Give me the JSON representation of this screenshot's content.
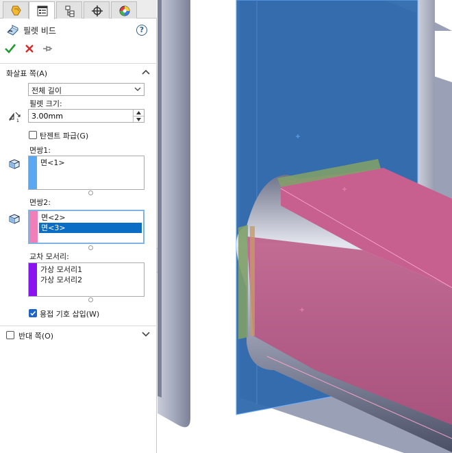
{
  "panel": {
    "title": "필렛 비드",
    "help_glyph": "?",
    "tabs": [
      "feature-manager-icon",
      "property-manager-icon",
      "configuration-manager-icon",
      "dimxpert-icon",
      "display-manager-icon"
    ],
    "actions": {
      "ok": "check-icon",
      "cancel": "close-icon",
      "pin": "pushpin-icon"
    },
    "arrow_side": {
      "header": "화살표 쪽(A)",
      "type_value": "전체 길이",
      "size_label": "필렛 크기:",
      "size_value": "3.00mm",
      "tangent_label": "탄젠트 파급(G)",
      "tangent_checked": false,
      "face_set1_label": "면쌍1:",
      "face_set1_items": [
        "면<1>"
      ],
      "face_set2_label": "면쌍2:",
      "face_set2_items": [
        "면<2>",
        "면<3>"
      ],
      "face_set2_selected": 1,
      "intersect_label": "교차 모서리:",
      "intersect_items": [
        "가상 모서리1",
        "가상 모서리2"
      ],
      "weld_symbol_label": "용접 기호 삽입(W)",
      "weld_symbol_checked": true
    },
    "other_side": {
      "header": "반대 쪽(O)",
      "checked": false
    }
  },
  "colors": {
    "face_set1": "#5aa7f2",
    "face_set2": "#f07fb8",
    "intersect": "#8a14f0",
    "selected_item": "#0b6dc4",
    "blue_plane": "#2f69ad",
    "pink_face": "#c7608f",
    "green_strip": "#7fa06a"
  }
}
